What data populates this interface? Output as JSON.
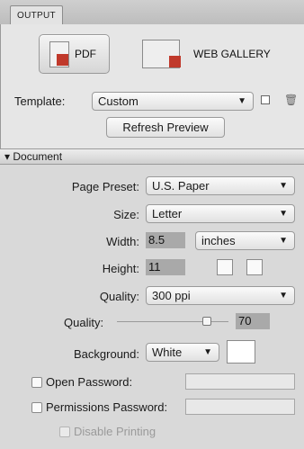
{
  "tabs": {
    "output": "OUTPUT"
  },
  "layout_buttons": {
    "pdf": "PDF",
    "web_gallery": "WEB GALLERY"
  },
  "template": {
    "label": "Template:",
    "value": "Custom",
    "refresh": "Refresh Preview"
  },
  "section": {
    "title": "▾ Document"
  },
  "document": {
    "page_preset_label": "Page Preset:",
    "page_preset_value": "U.S. Paper",
    "size_label": "Size:",
    "size_value": "Letter",
    "width_label": "Width:",
    "width_value": "8.5",
    "unit_value": "inches",
    "height_label": "Height:",
    "height_value": "11",
    "quality_label": "Quality:",
    "quality_value": "300 ppi",
    "quality_slider_label": "Quality:",
    "quality_slider_value": "70",
    "background_label": "Background:",
    "background_value": "White",
    "open_password_label": "Open Password:",
    "permissions_password_label": "Permissions Password:",
    "disable_printing_label": "Disable Printing"
  },
  "colors": {
    "background_swatch": "#ffffff",
    "pdf_accent": "#c0392b"
  }
}
